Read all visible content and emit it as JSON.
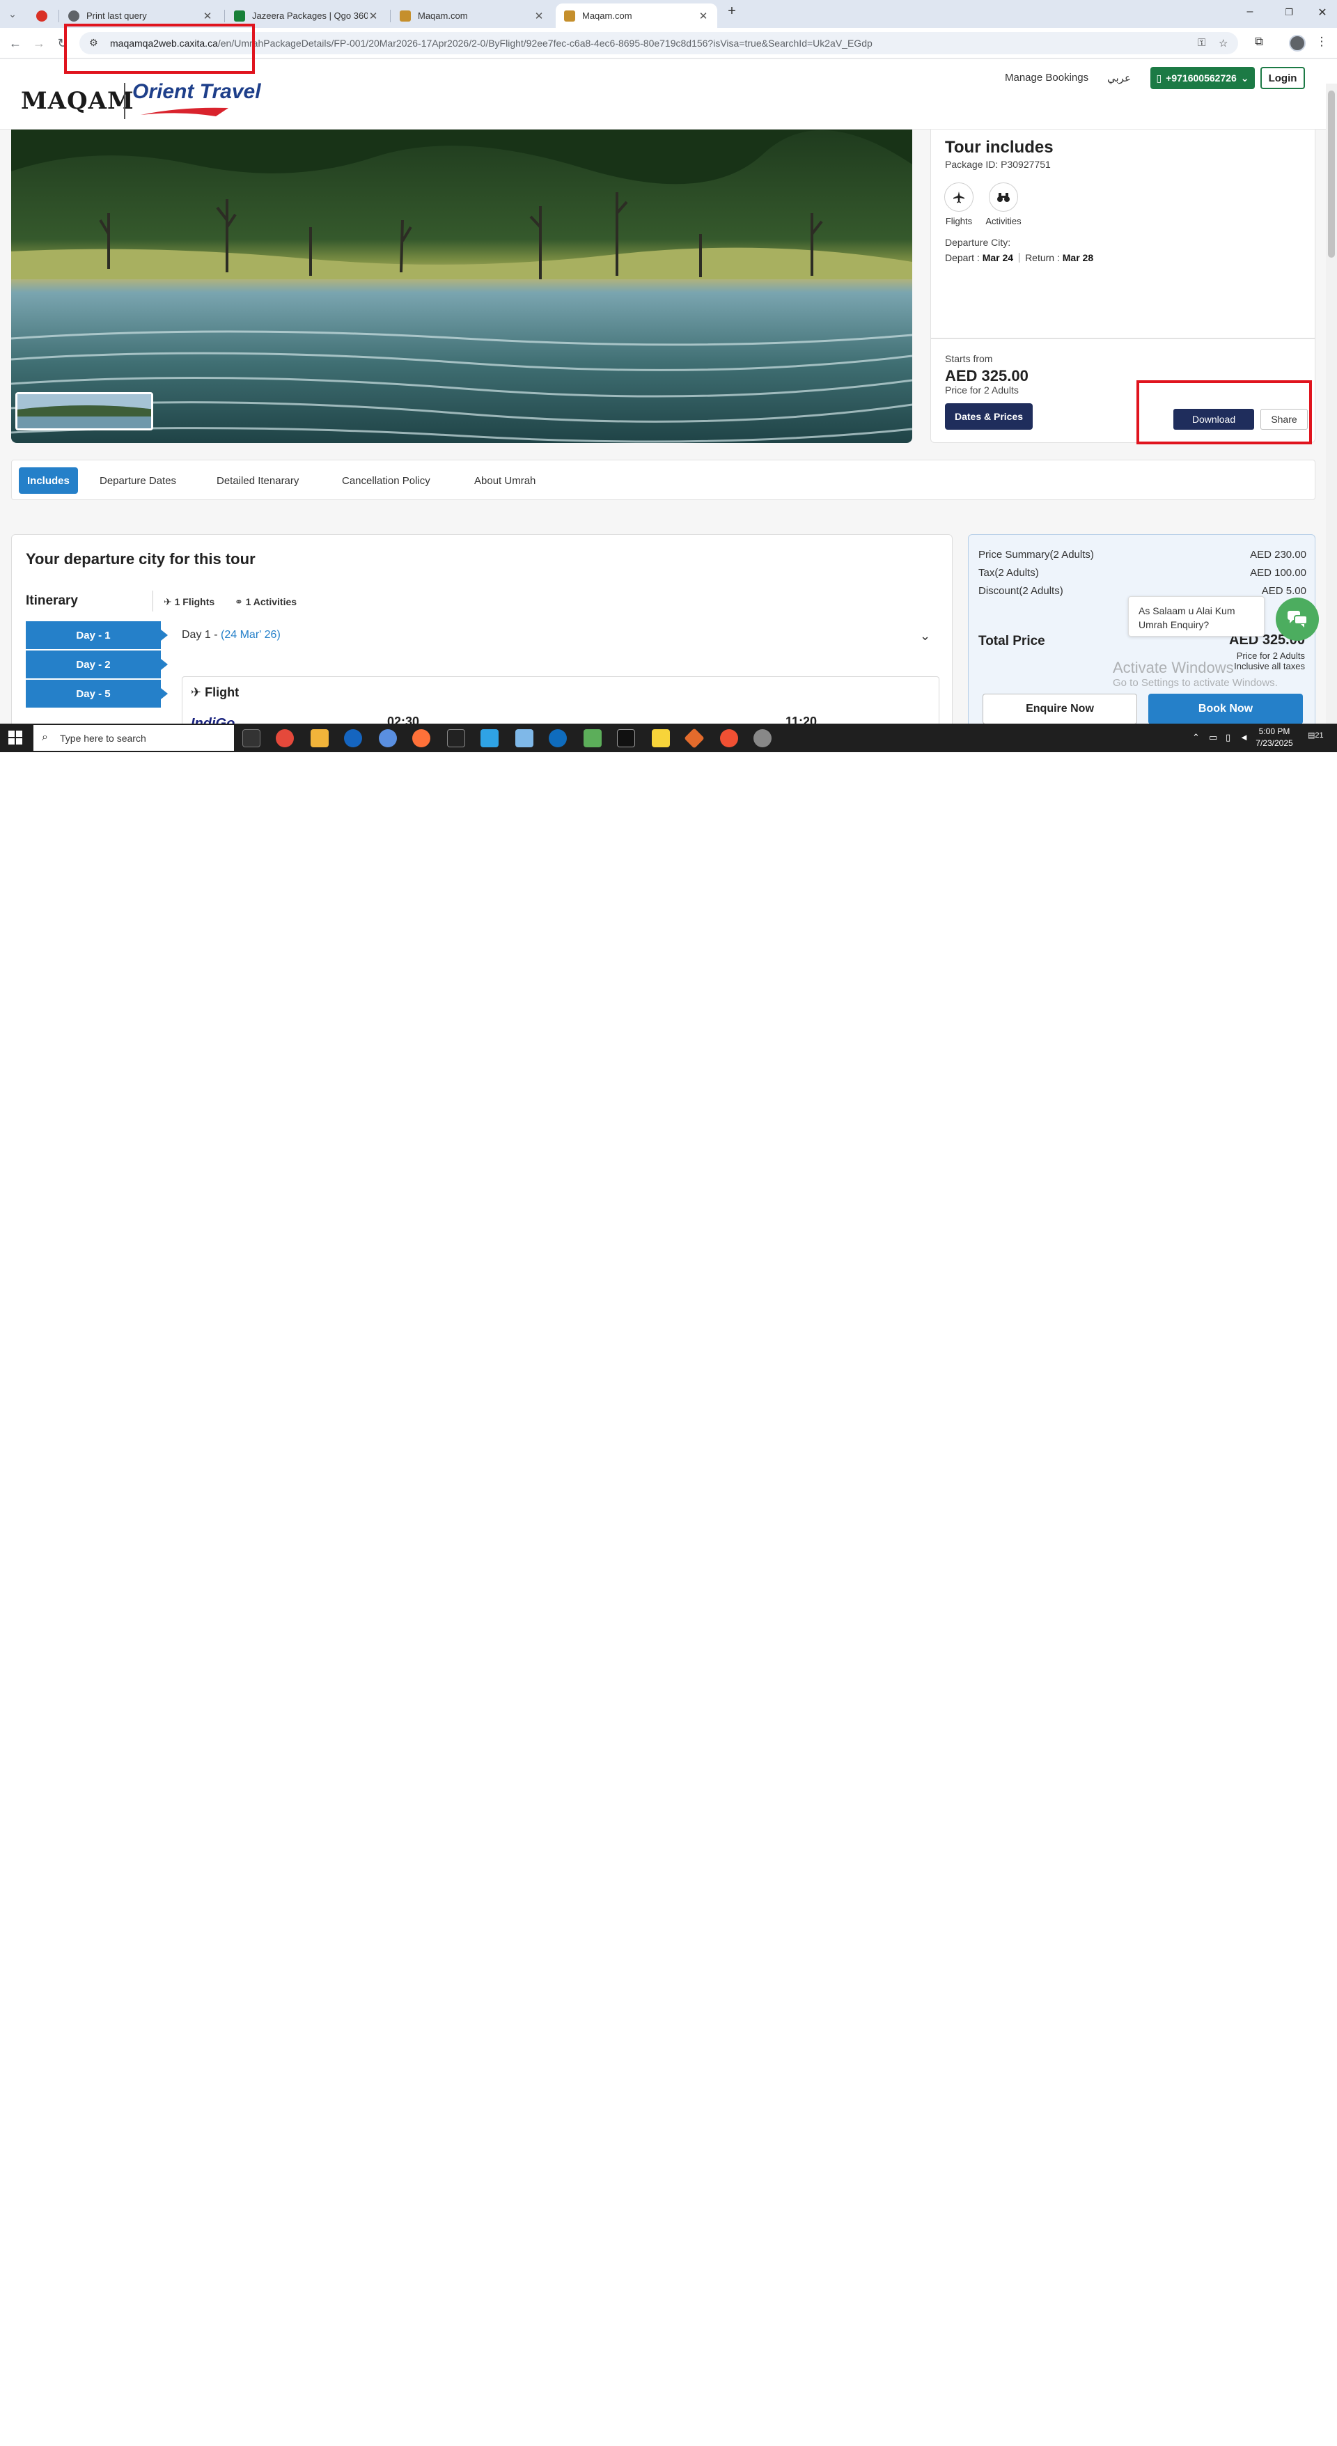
{
  "browser": {
    "tabs": [
      {
        "label": "",
        "color": "#d93025"
      },
      {
        "label": "Print last query",
        "color": "#5f6368"
      },
      {
        "label": "Jazeera Packages | Qgo 360 - G",
        "color": "#188038"
      },
      {
        "label": "Maqam.com",
        "color": "#c58f2c"
      },
      {
        "label": "Maqam.com",
        "color": "#c58f2c"
      }
    ],
    "url_host": "maqamqa2web.caxita.ca",
    "url_path": "/en/UmrahPackageDetails/FP-001/20Mar2026-17Apr2026/2-0/ByFlight/92ee7fec-c6a8-4ec6-8695-80e719c8d156?isVisa=true&SearchId=Uk2aV_EGdp"
  },
  "header": {
    "logo_maqam": "MAQAM",
    "logo_orient": "Orient Travel",
    "manage_bookings": "Manage Bookings",
    "arabic": "عربي",
    "phone": "+971600562726",
    "login": "Login"
  },
  "tour": {
    "title": "Tour includes",
    "package_id": "Package ID: P30927751",
    "includes": [
      {
        "label": "Flights",
        "icon": "plane-icon"
      },
      {
        "label": "Activities",
        "icon": "binoculars-icon"
      }
    ],
    "departure_city_label": "Departure City:",
    "depart_label": "Depart :",
    "depart_date": "Mar 24",
    "return_label": "Return :",
    "return_date": "Mar 28",
    "starts_from": "Starts from",
    "start_price": "AED 325.00",
    "price_for": "Price for 2 Adults",
    "dates_prices": "Dates & Prices",
    "download": "Download",
    "share": "Share"
  },
  "page_tabs": [
    "Includes",
    "Departure Dates",
    "Detailed Itenarary",
    "Cancellation Policy",
    "About Umrah"
  ],
  "main": {
    "title": "Your departure city for this tour",
    "itinerary": "Itinerary",
    "flights_count": "1 Flights",
    "activities_count": "1 Activities",
    "days": [
      "Day - 1",
      "Day - 2",
      "Day - 5"
    ],
    "day_head": "Day 1 -",
    "day_date": "(24 Mar' 26)",
    "flight_title": "Flight",
    "airline": "IndiGo",
    "dep_time": "02:30",
    "arr_time": "11:20"
  },
  "summary": {
    "rows": [
      {
        "label": "Price Summary(2 Adults)",
        "value": "AED 230.00"
      },
      {
        "label": "Tax(2 Adults)",
        "value": "AED 100.00"
      },
      {
        "label": "Discount(2 Adults)",
        "value": "AED 5.00"
      }
    ],
    "total_label": "Total Price",
    "total_value": "AED 325.00",
    "total_for": "Price for 2 Adults",
    "inclusive": "Inclusive all taxes",
    "enquire": "Enquire Now",
    "book": "Book Now"
  },
  "chat": {
    "line1": "As Salaam u Alai Kum",
    "line2": "Umrah Enquiry?"
  },
  "watermark": {
    "title": "Activate Windows",
    "sub": "Go to Settings to activate Windows."
  },
  "taskbar": {
    "search_placeholder": "Type here to search",
    "time": "5:00 PM",
    "date": "7/23/2025",
    "notif_count": "21"
  },
  "colors": {
    "accent_blue": "#2580c9",
    "navy": "#1f2d5c",
    "green": "#1c7a45",
    "highlight_red": "#e0141e"
  }
}
